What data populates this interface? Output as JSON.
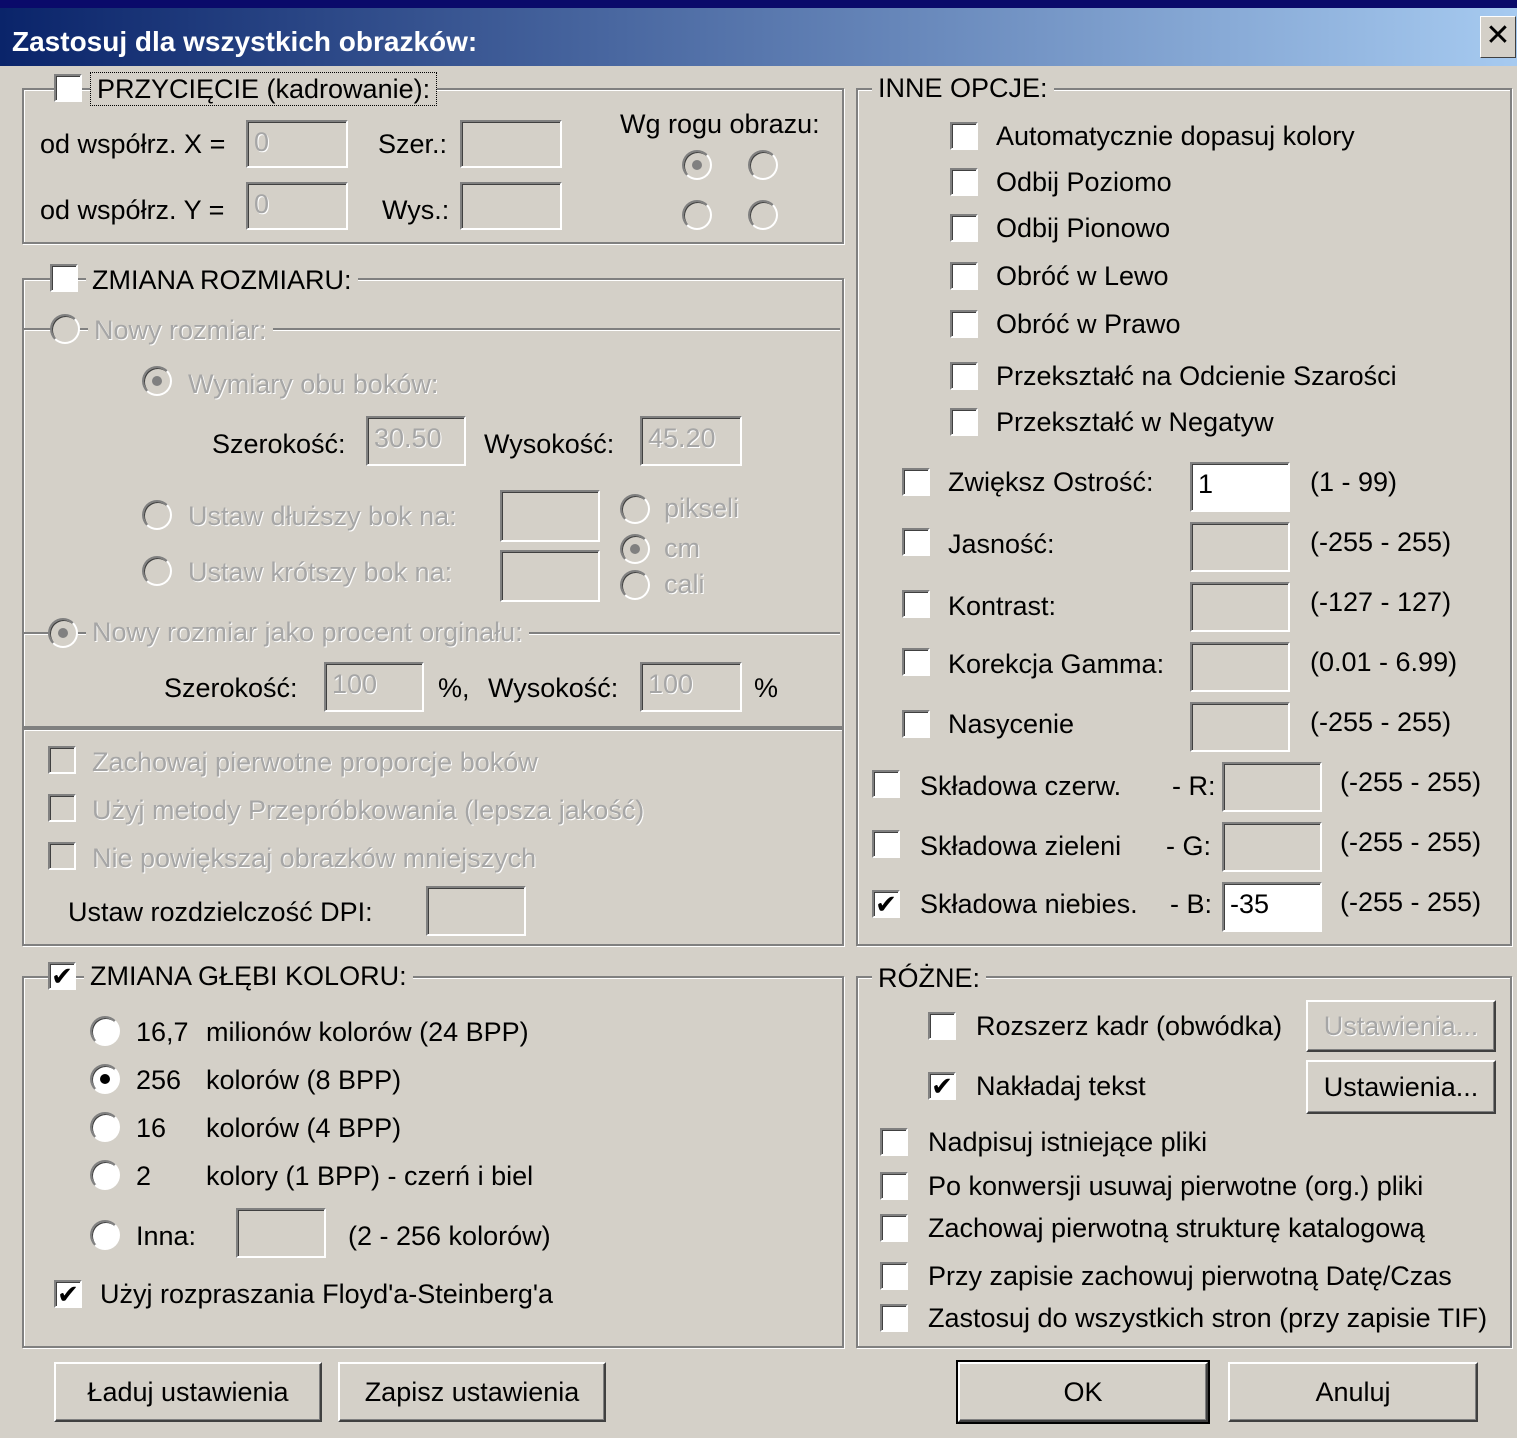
{
  "window": {
    "title": "Zastosuj dla wszystkich obrazków:",
    "close": "✕"
  },
  "crop": {
    "label": "PRZYCIĘCIE  (kadrowanie):",
    "x_label": "od współrz. X =",
    "x_value": "0",
    "y_label": "od współrz. Y =",
    "y_value": "0",
    "width_label": "Szer.:",
    "width_value": "",
    "height_label": "Wys.:",
    "height_value": "",
    "corner_label": "Wg rogu obrazu:"
  },
  "resize": {
    "label": "ZMIANA ROZMIARU:",
    "new_size": "Nowy rozmiar:",
    "both_sides": "Wymiary obu boków:",
    "width_label": "Szerokość:",
    "width_value": "30.50",
    "height_label": "Wysokość:",
    "height_value": "45.20",
    "longer_side": "Ustaw dłuższy bok na:",
    "shorter_side": "Ustaw krótszy bok na:",
    "units": [
      "pikseli",
      "cm",
      "cali"
    ],
    "percent_option": "Nowy rozmiar jako procent orginału:",
    "pct_width_label": "Szerokość:",
    "pct_width_value": "100",
    "pct_unit1": "%,",
    "pct_height_label": "Wysokość:",
    "pct_height_value": "100",
    "pct_unit2": "%"
  },
  "resize_opts": {
    "keep_ratio": "Zachowaj pierwotne proporcje boków",
    "resample": "Użyj metody Przepróbkowania (lepsza jakość)",
    "no_enlarge": "Nie powiększaj obrazków mniejszych",
    "dpi_label": "Ustaw rozdzielczość DPI:",
    "dpi_value": ""
  },
  "color_depth": {
    "label": "ZMIANA GŁĘBI KOLORU:",
    "options": [
      {
        "num": "16,7",
        "desc": "milionów kolorów (24 BPP)"
      },
      {
        "num": "256",
        "desc": "kolorów (8 BPP)"
      },
      {
        "num": "16",
        "desc": "kolorów (4 BPP)"
      },
      {
        "num": "2",
        "desc": "kolory (1 BPP) - czerń i biel"
      }
    ],
    "other_label": "Inna:",
    "other_value": "",
    "other_range": "(2 - 256 kolorów)",
    "dither": "Użyj rozpraszania Floyd'a-Steinberg'a"
  },
  "other": {
    "label": "INNE OPCJE:",
    "checks": [
      "Automatycznie dopasuj kolory",
      "Odbij Poziomo",
      "Odbij Pionowo",
      "Obróć w Lewo",
      "Obróć w Prawo",
      "Przekształć na Odcienie Szarości",
      "Przekształć w Negatyw"
    ],
    "sharpen_label": "Zwiększ Ostrość:",
    "sharpen_value": "1",
    "sharpen_range": "(1  -  99)",
    "brightness_label": "Jasność:",
    "brightness_range": "(-255  -  255)",
    "contrast_label": "Kontrast:",
    "contrast_range": "(-127  -  127)",
    "gamma_label": "Korekcja Gamma:",
    "gamma_range": "(0.01  -  6.99)",
    "saturation_label": "Nasycenie",
    "saturation_range": "(-255  -  255)",
    "red_label": "Składowa czerw.",
    "red_key": "- R:",
    "red_range": "(-255  -  255)",
    "green_label": "Składowa zieleni",
    "green_key": "- G:",
    "green_range": "(-255  -  255)",
    "blue_label": "Składowa niebies.",
    "blue_key": "- B:",
    "blue_value": "-35",
    "blue_range": "(-255  -  255)"
  },
  "misc": {
    "label": "RÓŻNE:",
    "frame": "Rozszerz kadr (obwódka)",
    "frame_btn": "Ustawienia...",
    "text": "Nakładaj tekst",
    "text_btn": "Ustawienia...",
    "checks": [
      "Nadpisuj istniejące pliki",
      "Po konwersji usuwaj pierwotne (org.) pliki",
      "Zachowaj pierwotną strukturę katalogową",
      "Przy zapisie zachowuj pierwotną Datę/Czas",
      "Zastosuj do wszystkich stron (przy zapisie TIF)"
    ]
  },
  "buttons": {
    "load": "Ładuj ustawienia",
    "save": "Zapisz ustawienia",
    "ok": "OK",
    "cancel": "Anuluj"
  },
  "checkmark": "✔"
}
